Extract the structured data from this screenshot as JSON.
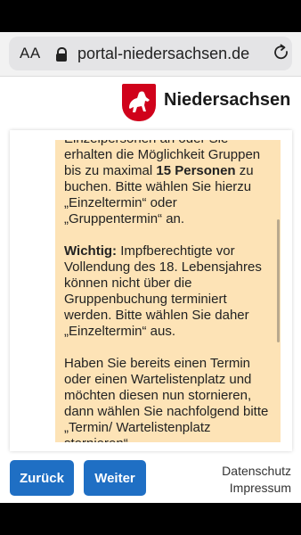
{
  "browser": {
    "text_size_label": "AA",
    "url": "portal-niedersachsen.de"
  },
  "header": {
    "brand": "Niedersachsen"
  },
  "info": {
    "paragraph1_fragment": "Einzelpersonen an oder Sie erhalten",
    "paragraph1_line2": "die Möglichkeit Gruppen bis zu maximal",
    "paragraph1_bold": "15 Personen",
    "paragraph1_rest": "zu buchen. Bitte wählen Sie hierzu „Einzeltermin“ oder „Gruppentermin“ an.",
    "paragraph2_bold": "Wichtig:",
    "paragraph2_rest": "Impfberechtigte vor Vollendung des 18. Lebensjahres können nicht über die Gruppenbuchung terminiert werden. Bitte wählen Sie daher „Einzeltermin“ aus.",
    "paragraph3": "Haben Sie bereits einen Termin oder einen Wartelistenplatz und möchten diesen nun stornieren, dann wählen Sie nachfolgend bitte „Termin/ Wartelistenplatz stornieren“"
  },
  "actions": {
    "back_label": "Zurück",
    "next_label": "Weiter"
  },
  "footer": {
    "privacy_label": "Datenschutz",
    "imprint_label": "Impressum"
  },
  "colors": {
    "brand_red": "#d0021b",
    "button_blue": "#1f6fc4",
    "info_background": "#fde3b6"
  }
}
